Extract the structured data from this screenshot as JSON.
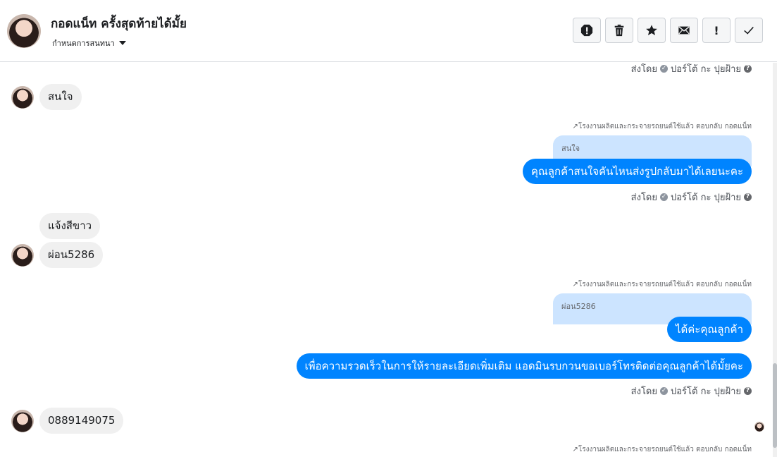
{
  "header": {
    "title": "กอดแน็ท ครั้งสุดท้ายได้มั้ย",
    "subtitle": "กำหนดการสนทนา",
    "toolbar": [
      {
        "name": "report-icon",
        "label": ""
      },
      {
        "name": "trash-icon",
        "label": ""
      },
      {
        "name": "star-icon",
        "label": ""
      },
      {
        "name": "mail-icon",
        "label": ""
      },
      {
        "name": "exclamation-icon",
        "label": "!"
      },
      {
        "name": "check-icon",
        "label": "✓"
      }
    ]
  },
  "sent_by": {
    "prefix": "ส่งโดย",
    "name": "ปอร์โต้ กะ ปุยฝ้าย"
  },
  "reply_label": "โรงงานผลิตและกระจายรถยนต์ใช้แล้ว ตอบกลับ กอดแน็ท",
  "messages": {
    "in1": "สนใจ",
    "quote1": "สนใจ",
    "out1": "คุณลูกค้าสนใจคันไหนส่งรูปกลับมาได้เลยนะคะ",
    "in2": "แจ้งสีขาว",
    "in3": "ผ่อน5286",
    "quote2": "ผ่อน5286",
    "out2": "ได้ค่ะคุณลูกค้า",
    "out3": "เพื่อความรวดเร็วในการให้รายละเอียดเพิ่มเติม แอดมินรบกวนขอเบอร์โทรติดต่อคุณลูกค้าได้มั้ยคะ",
    "in4": "0889149075"
  },
  "colors": {
    "outgoing_bubble": "#0084ff",
    "incoming_bubble": "#f0f0f0",
    "quote_bubble": "#cce4ff"
  }
}
